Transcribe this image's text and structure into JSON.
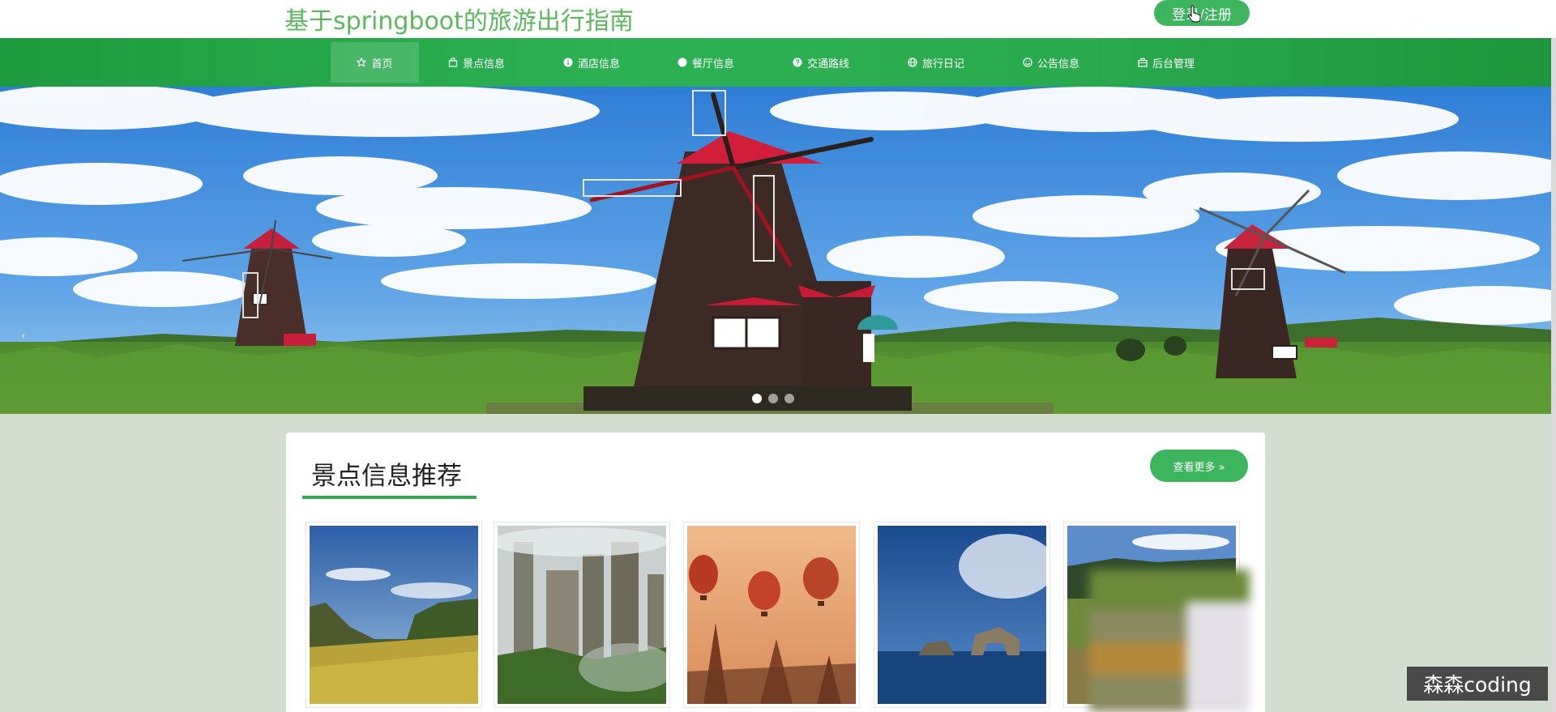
{
  "header": {
    "site_title": "基于springboot的旅游出行指南",
    "login_button": "登录/注册"
  },
  "nav": {
    "items": [
      {
        "label": "首页",
        "icon": "star-icon",
        "active": true
      },
      {
        "label": "景点信息",
        "icon": "shopping-bag-icon"
      },
      {
        "label": "酒店信息",
        "icon": "info-circle-icon"
      },
      {
        "label": "餐厅信息",
        "icon": "dot-circle-icon"
      },
      {
        "label": "交通路线",
        "icon": "help-circle-icon"
      },
      {
        "label": "旅行日记",
        "icon": "globe-icon"
      },
      {
        "label": "公告信息",
        "icon": "smile-icon"
      },
      {
        "label": "后台管理",
        "icon": "briefcase-icon"
      }
    ]
  },
  "banner": {
    "slide_count": 3,
    "active_slide": 1,
    "prev_arrow": "‹"
  },
  "section": {
    "title": "景点信息推荐",
    "more_button": "查看更多 »"
  },
  "thumbnails": [
    {
      "scene": "mountain-meadow"
    },
    {
      "scene": "stone-pillars"
    },
    {
      "scene": "hot-air-balloons"
    },
    {
      "scene": "sea-arch"
    },
    {
      "scene": "lake-valley"
    }
  ],
  "watermark": "森森coding",
  "colors": {
    "brand_green": "#3cb55e",
    "nav_green": "#2db155",
    "title_green": "#5cb85c",
    "page_bg": "#d2ddd0"
  }
}
